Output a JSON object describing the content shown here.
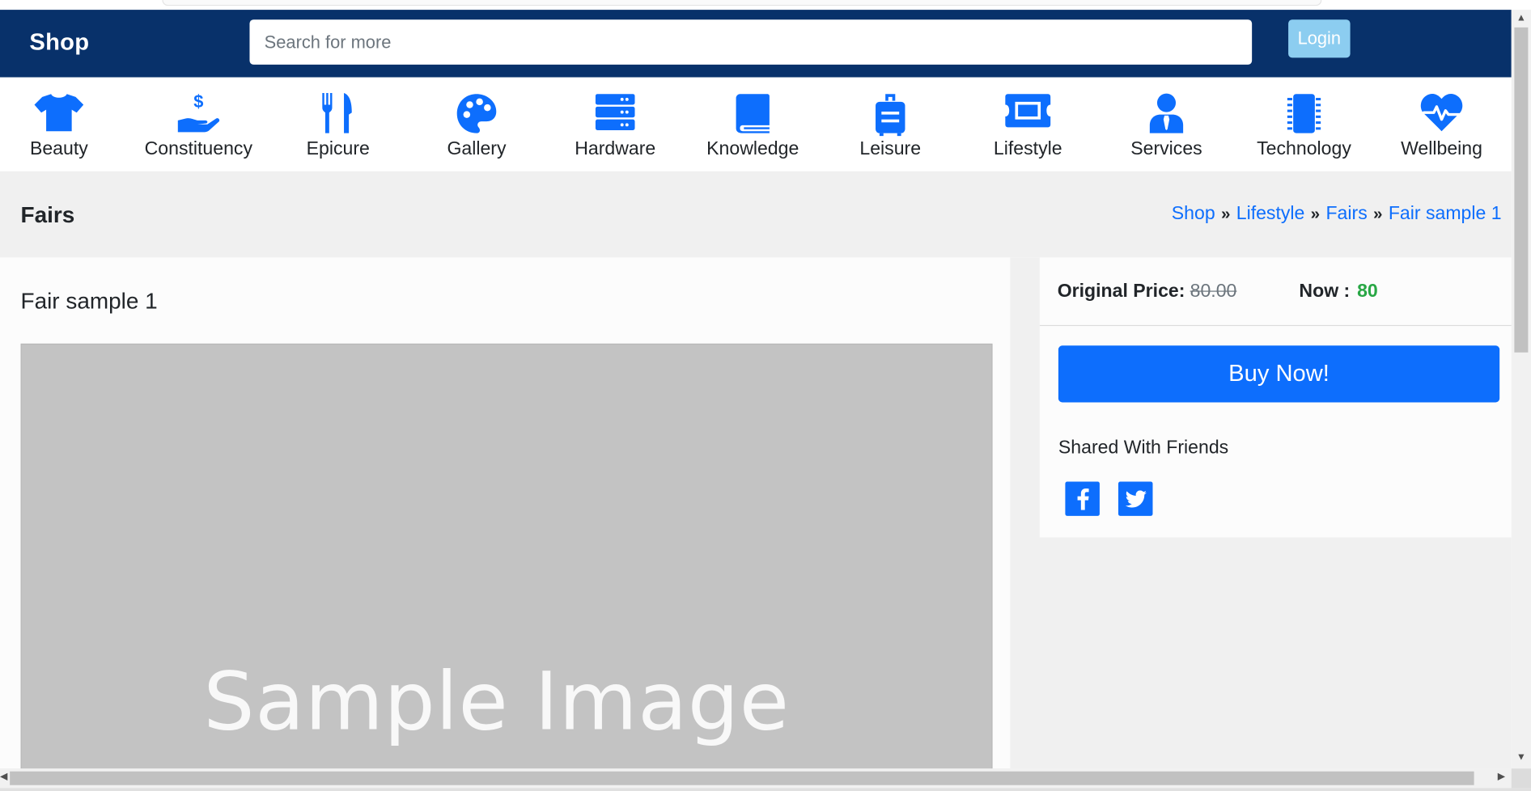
{
  "header": {
    "brand": "Shop",
    "search_placeholder": "Search for more",
    "login_label": "Login",
    "bg_color": "#08316a"
  },
  "categories": [
    {
      "label": "Beauty",
      "icon": "tshirt-icon"
    },
    {
      "label": "Constituency",
      "icon": "hand-holding-dollar-icon"
    },
    {
      "label": "Epicure",
      "icon": "utensils-icon"
    },
    {
      "label": "Gallery",
      "icon": "palette-icon"
    },
    {
      "label": "Hardware",
      "icon": "server-icon"
    },
    {
      "label": "Knowledge",
      "icon": "book-icon"
    },
    {
      "label": "Leisure",
      "icon": "suitcase-icon"
    },
    {
      "label": "Lifestyle",
      "icon": "ticket-icon"
    },
    {
      "label": "Services",
      "icon": "user-tie-icon"
    },
    {
      "label": "Technology",
      "icon": "microchip-icon"
    },
    {
      "label": "Wellbeing",
      "icon": "heartbeat-icon"
    }
  ],
  "page": {
    "title": "Fairs",
    "breadcrumb": [
      "Shop",
      "Lifestyle",
      "Fairs",
      "Fair sample 1"
    ]
  },
  "product": {
    "title": "Fair sample 1",
    "image_text": "Sample Image",
    "original_price_label": "Original Price:",
    "original_price": "80.00",
    "now_label": "Now :",
    "now_price": "80",
    "buy_label": "Buy Now!",
    "share_label": "Shared With Friends",
    "social": [
      "facebook-icon",
      "twitter-icon"
    ]
  },
  "colors": {
    "accent": "#0d6efd",
    "price_green": "#28a745",
    "login_bg": "#8ccdf0"
  }
}
